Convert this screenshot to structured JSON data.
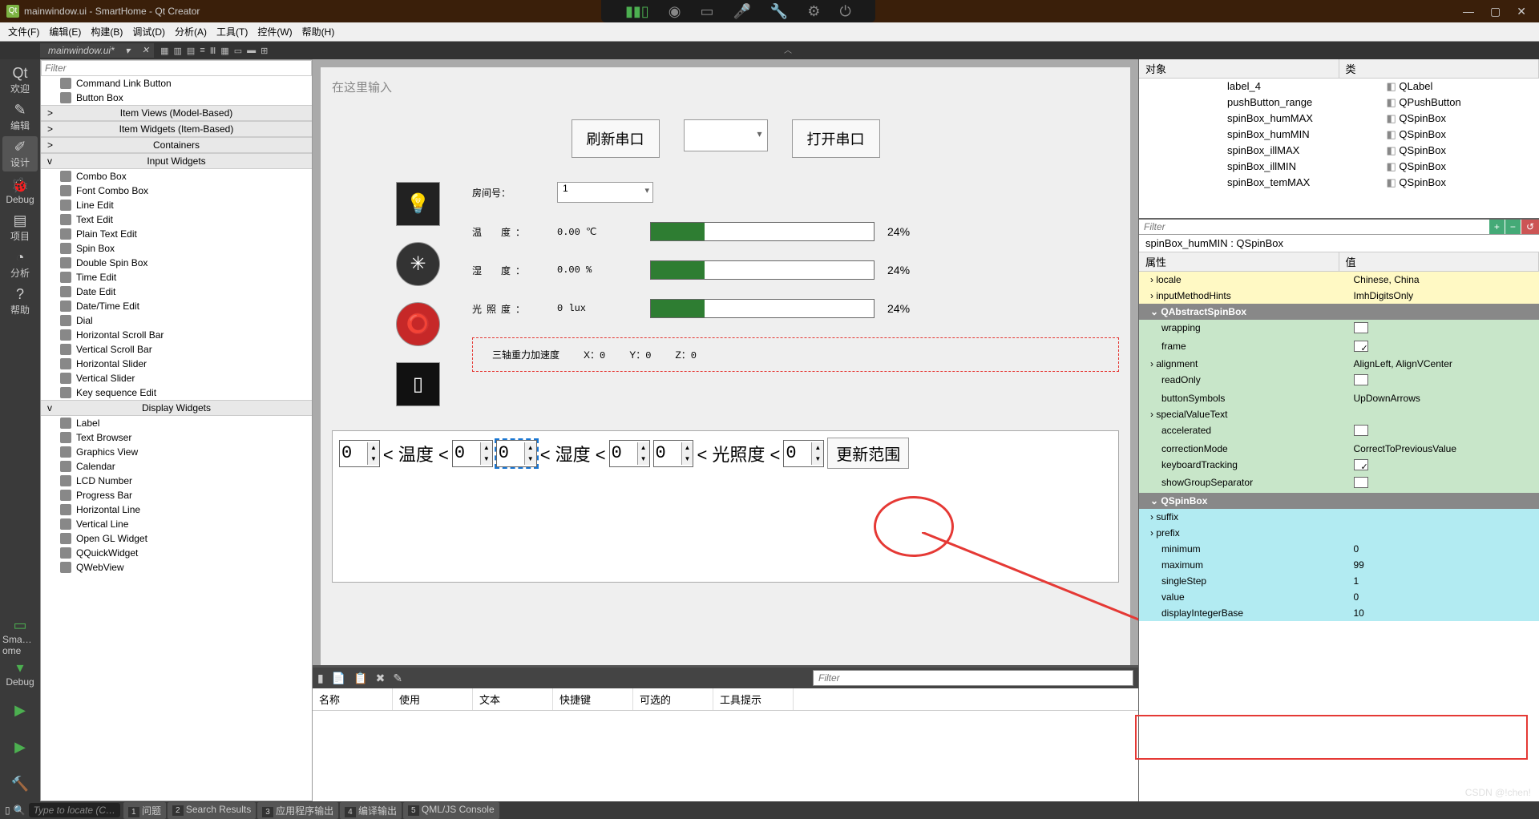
{
  "window": {
    "title": "mainwindow.ui - SmartHome - Qt Creator"
  },
  "menus": [
    "文件(F)",
    "编辑(E)",
    "构建(B)",
    "调试(D)",
    "分析(A)",
    "工具(T)",
    "控件(W)",
    "帮助(H)"
  ],
  "open_tab": "mainwindow.ui*",
  "filter_placeholder": "Filter",
  "widget_categories": [
    {
      "name": "Command Link Button",
      "type": "item"
    },
    {
      "name": "Button Box",
      "type": "item"
    },
    {
      "name": "Item Views (Model-Based)",
      "type": "cat"
    },
    {
      "name": "Item Widgets (Item-Based)",
      "type": "cat"
    },
    {
      "name": "Containers",
      "type": "cat"
    },
    {
      "name": "Input Widgets",
      "type": "cat",
      "open": true
    },
    {
      "name": "Combo Box",
      "type": "item"
    },
    {
      "name": "Font Combo Box",
      "type": "item"
    },
    {
      "name": "Line Edit",
      "type": "item"
    },
    {
      "name": "Text Edit",
      "type": "item"
    },
    {
      "name": "Plain Text Edit",
      "type": "item"
    },
    {
      "name": "Spin Box",
      "type": "item"
    },
    {
      "name": "Double Spin Box",
      "type": "item"
    },
    {
      "name": "Time Edit",
      "type": "item"
    },
    {
      "name": "Date Edit",
      "type": "item"
    },
    {
      "name": "Date/Time Edit",
      "type": "item"
    },
    {
      "name": "Dial",
      "type": "item"
    },
    {
      "name": "Horizontal Scroll Bar",
      "type": "item"
    },
    {
      "name": "Vertical Scroll Bar",
      "type": "item"
    },
    {
      "name": "Horizontal Slider",
      "type": "item"
    },
    {
      "name": "Vertical Slider",
      "type": "item"
    },
    {
      "name": "Key sequence Edit",
      "type": "item"
    },
    {
      "name": "Display Widgets",
      "type": "cat",
      "open": true
    },
    {
      "name": "Label",
      "type": "item"
    },
    {
      "name": "Text Browser",
      "type": "item"
    },
    {
      "name": "Graphics View",
      "type": "item"
    },
    {
      "name": "Calendar",
      "type": "item"
    },
    {
      "name": "LCD Number",
      "type": "item"
    },
    {
      "name": "Progress Bar",
      "type": "item"
    },
    {
      "name": "Horizontal Line",
      "type": "item"
    },
    {
      "name": "Vertical Line",
      "type": "item"
    },
    {
      "name": "Open GL Widget",
      "type": "item"
    },
    {
      "name": "QQuickWidget",
      "type": "item"
    },
    {
      "name": "QWebView",
      "type": "item"
    }
  ],
  "leftbar": [
    {
      "label": "欢迎",
      "icon": "Qt"
    },
    {
      "label": "编辑",
      "icon": "✎"
    },
    {
      "label": "设计",
      "icon": "✐",
      "active": true
    },
    {
      "label": "Debug",
      "icon": "🐞"
    },
    {
      "label": "项目",
      "icon": "▤"
    },
    {
      "label": "分析",
      "icon": "◔"
    },
    {
      "label": "帮助",
      "icon": "?"
    }
  ],
  "leftbar_bottom": [
    {
      "label": "Sma…ome",
      "icon": "▭"
    },
    {
      "label": "Debug",
      "icon": "▾"
    },
    {
      "label": "",
      "icon": "▶"
    },
    {
      "label": "",
      "icon": "▶"
    },
    {
      "label": "",
      "icon": "🔨"
    }
  ],
  "form": {
    "placeholder": "在这里输入",
    "btn_refresh": "刷新串口",
    "btn_open": "打开串口",
    "room_label": "房间号：",
    "room_value": "1",
    "rows": [
      {
        "label": "温　度：",
        "value": "0.00 ℃",
        "pct": "24%"
      },
      {
        "label": "湿　度：",
        "value": "0.00 %",
        "pct": "24%"
      },
      {
        "label": "光照度：",
        "value": "0 lux",
        "pct": "24%"
      }
    ],
    "accel": {
      "prefix": "三轴重力加速度",
      "x": "X：",
      "xv": "0",
      "y": "Y：",
      "yv": "0",
      "z": "Z：",
      "zv": "0"
    },
    "range": {
      "temp": "< 温度 <",
      "hum": "< 湿度 <",
      "ill": "< 光照度 <",
      "vals": [
        "0",
        "0",
        "0",
        "0",
        "0",
        "0"
      ],
      "update": "更新范围"
    }
  },
  "action_headers": [
    "名称",
    "使用",
    "文本",
    "快捷键",
    "可选的",
    "工具提示"
  ],
  "objects_header": {
    "obj": "对象",
    "cls": "类"
  },
  "objects": [
    {
      "name": "label_4",
      "cls": "QLabel"
    },
    {
      "name": "pushButton_range",
      "cls": "QPushButton"
    },
    {
      "name": "spinBox_humMAX",
      "cls": "QSpinBox"
    },
    {
      "name": "spinBox_humMIN",
      "cls": "QSpinBox"
    },
    {
      "name": "spinBox_illMAX",
      "cls": "QSpinBox"
    },
    {
      "name": "spinBox_illMIN",
      "cls": "QSpinBox"
    },
    {
      "name": "spinBox_temMAX",
      "cls": "QSpinBox"
    }
  ],
  "prop_selected": "spinBox_humMIN : QSpinBox",
  "prop_header": {
    "k": "属性",
    "v": "值"
  },
  "props": [
    {
      "k": "locale",
      "v": "Chinese, China",
      "cls": "yellow",
      "exp": true
    },
    {
      "k": "inputMethodHints",
      "v": "ImhDigitsOnly",
      "cls": "yellow",
      "exp": true
    },
    {
      "k": "QAbstractSpinBox",
      "v": "",
      "cls": "grouphdr"
    },
    {
      "k": "wrapping",
      "v": "",
      "cls": "green",
      "chk": false
    },
    {
      "k": "frame",
      "v": "",
      "cls": "green",
      "chk": true
    },
    {
      "k": "alignment",
      "v": "AlignLeft, AlignVCenter",
      "cls": "green",
      "exp": true
    },
    {
      "k": "readOnly",
      "v": "",
      "cls": "green",
      "chk": false
    },
    {
      "k": "buttonSymbols",
      "v": "UpDownArrows",
      "cls": "green"
    },
    {
      "k": "specialValueText",
      "v": "",
      "cls": "green",
      "exp": true
    },
    {
      "k": "accelerated",
      "v": "",
      "cls": "green",
      "chk": false
    },
    {
      "k": "correctionMode",
      "v": "CorrectToPreviousValue",
      "cls": "green"
    },
    {
      "k": "keyboardTracking",
      "v": "",
      "cls": "green",
      "chk": true
    },
    {
      "k": "showGroupSeparator",
      "v": "",
      "cls": "green",
      "chk": false
    },
    {
      "k": "QSpinBox",
      "v": "",
      "cls": "grouphdr"
    },
    {
      "k": "suffix",
      "v": "",
      "cls": "cyan",
      "exp": true
    },
    {
      "k": "prefix",
      "v": "",
      "cls": "cyan",
      "exp": true
    },
    {
      "k": "minimum",
      "v": "0",
      "cls": "cyan"
    },
    {
      "k": "maximum",
      "v": "99",
      "cls": "cyan"
    },
    {
      "k": "singleStep",
      "v": "1",
      "cls": "cyan"
    },
    {
      "k": "value",
      "v": "0",
      "cls": "cyan"
    },
    {
      "k": "displayIntegerBase",
      "v": "10",
      "cls": "cyan"
    }
  ],
  "status": {
    "locate": "Type to locate (C…",
    "tabs": [
      [
        "1",
        "问题"
      ],
      [
        "2",
        "Search Results"
      ],
      [
        "3",
        "应用程序输出"
      ],
      [
        "4",
        "编译输出"
      ],
      [
        "5",
        "QML/JS Console"
      ]
    ]
  },
  "watermark": "CSDN @!chen!"
}
